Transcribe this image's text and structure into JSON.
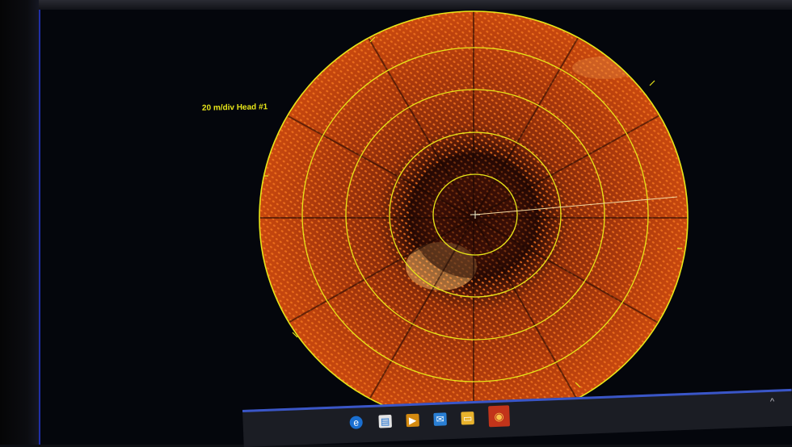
{
  "display": {
    "scale_label": "20 m/div Head #1"
  },
  "taskbar": {
    "icons": [
      "edge-icon",
      "store-icon",
      "media-player-icon",
      "mail-icon",
      "file-explorer-icon",
      "sonar-app-icon"
    ]
  },
  "colors": {
    "scan_fill": "#b8400e",
    "range_ring": "#e8e619",
    "background": "#04060c"
  }
}
